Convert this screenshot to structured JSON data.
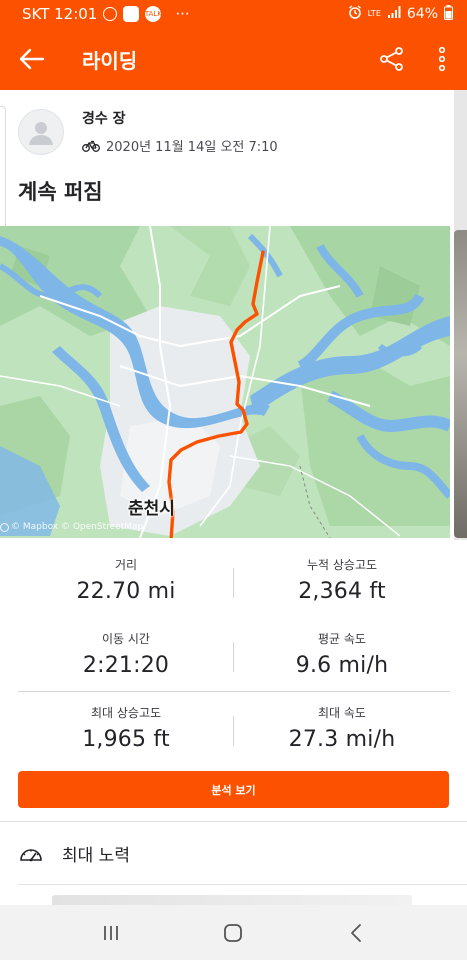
{
  "status_bar": {
    "carrier_time": "SKT 12:01",
    "dots": "···",
    "network": "LTE",
    "battery": "64%"
  },
  "app_bar": {
    "title": "라이딩"
  },
  "activity": {
    "athlete_name": "경수 장",
    "datetime": "2020년 11월 14일 오전 7:10",
    "title": "계속 퍼짐"
  },
  "map": {
    "city_label": "춘천시",
    "attribution": "© Mapbox © OpenStreetMap",
    "route_color": "#fc5200"
  },
  "stats": [
    {
      "label": "거리",
      "value": "22.70 mi"
    },
    {
      "label": "누적 상승고도",
      "value": "2,364 ft"
    },
    {
      "label": "이동 시간",
      "value": "2:21:20"
    },
    {
      "label": "평균 속도",
      "value": "9.6 mi/h"
    },
    {
      "label": "최대 상승고도",
      "value": "1,965 ft"
    },
    {
      "label": "최대 속도",
      "value": "27.3 mi/h"
    }
  ],
  "analysis_button": "분석 보기",
  "effort_row": {
    "label": "최대 노력",
    "icon": "speedometer-icon"
  },
  "colors": {
    "brand": "#fc5200",
    "text": "#242428"
  }
}
